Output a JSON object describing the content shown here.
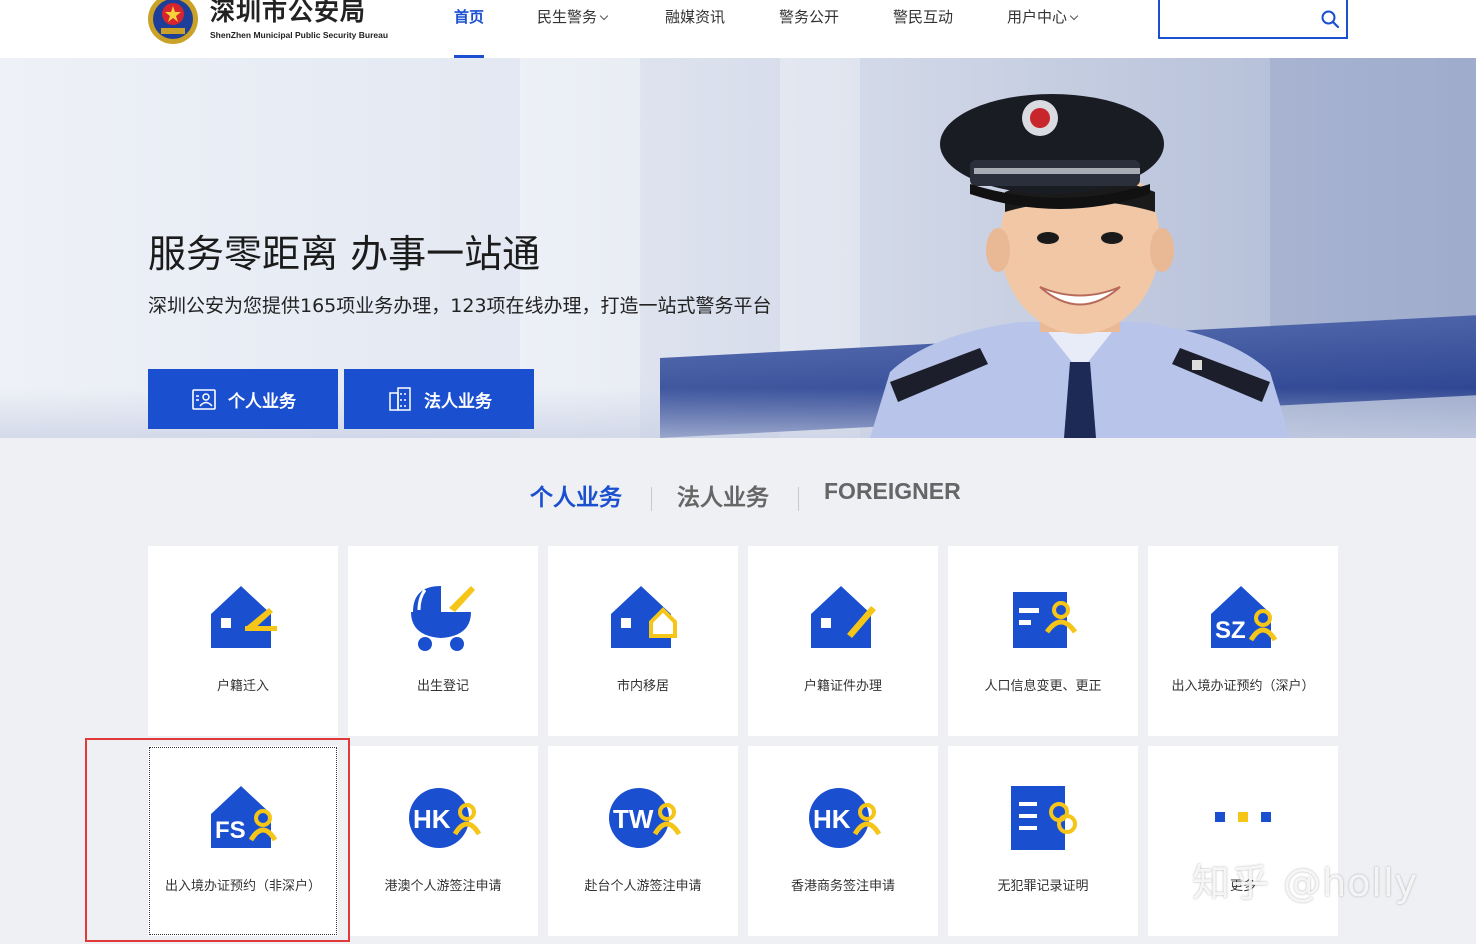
{
  "header": {
    "brand_cn": "深圳市公安局",
    "brand_en": "ShenZhen Municipal Public Security Bureau",
    "nav": [
      {
        "label": "首页",
        "active": true,
        "dropdown": false
      },
      {
        "label": "民生警务",
        "active": false,
        "dropdown": true
      },
      {
        "label": "融媒资讯",
        "active": false,
        "dropdown": false
      },
      {
        "label": "警务公开",
        "active": false,
        "dropdown": false
      },
      {
        "label": "警民互动",
        "active": false,
        "dropdown": false
      },
      {
        "label": "用户中心",
        "active": false,
        "dropdown": true
      }
    ],
    "search": {
      "placeholder": "",
      "value": ""
    }
  },
  "banner": {
    "title": "服务零距离 办事一站通",
    "subtitle": "深圳公安为您提供165项业务办理，123项在线办理，打造一站式警务平台",
    "buttons": [
      {
        "label": "个人业务",
        "icon": "personal-id-icon"
      },
      {
        "label": "法人业务",
        "icon": "building-icon"
      }
    ]
  },
  "tabs": [
    {
      "label": "个人业务",
      "active": true
    },
    {
      "label": "法人业务",
      "active": false
    },
    {
      "label": "FOREIGNER",
      "active": false
    }
  ],
  "services": [
    {
      "label": "户籍迁入",
      "icon": "house-pen-icon"
    },
    {
      "label": "出生登记",
      "icon": "stroller-icon"
    },
    {
      "label": "市内移居",
      "icon": "house-move-icon"
    },
    {
      "label": "户籍证件办理",
      "icon": "house-document-icon"
    },
    {
      "label": "人口信息变更、更正",
      "icon": "id-card-person-icon"
    },
    {
      "label": "出入境办证预约（深户）",
      "icon": "sz-house-person-icon",
      "badge": "SZ"
    },
    {
      "label": "出入境办证预约（非深户）",
      "icon": "fs-house-person-icon",
      "badge": "FS"
    },
    {
      "label": "港澳个人游签注申请",
      "icon": "hk-circle-person-icon",
      "badge": "HK"
    },
    {
      "label": "赴台个人游签注申请",
      "icon": "tw-circle-person-icon",
      "badge": "TW"
    },
    {
      "label": "香港商务签注申请",
      "icon": "hk-business-person-icon",
      "badge": "HK"
    },
    {
      "label": "无犯罪记录证明",
      "icon": "record-handcuffs-icon"
    },
    {
      "label": "更多",
      "icon": "more-dots-icon"
    }
  ],
  "colors": {
    "primary": "#1a4fd0",
    "accent": "#f5c518",
    "highlight": "#e03a3a"
  },
  "watermark": "知乎 @holly"
}
